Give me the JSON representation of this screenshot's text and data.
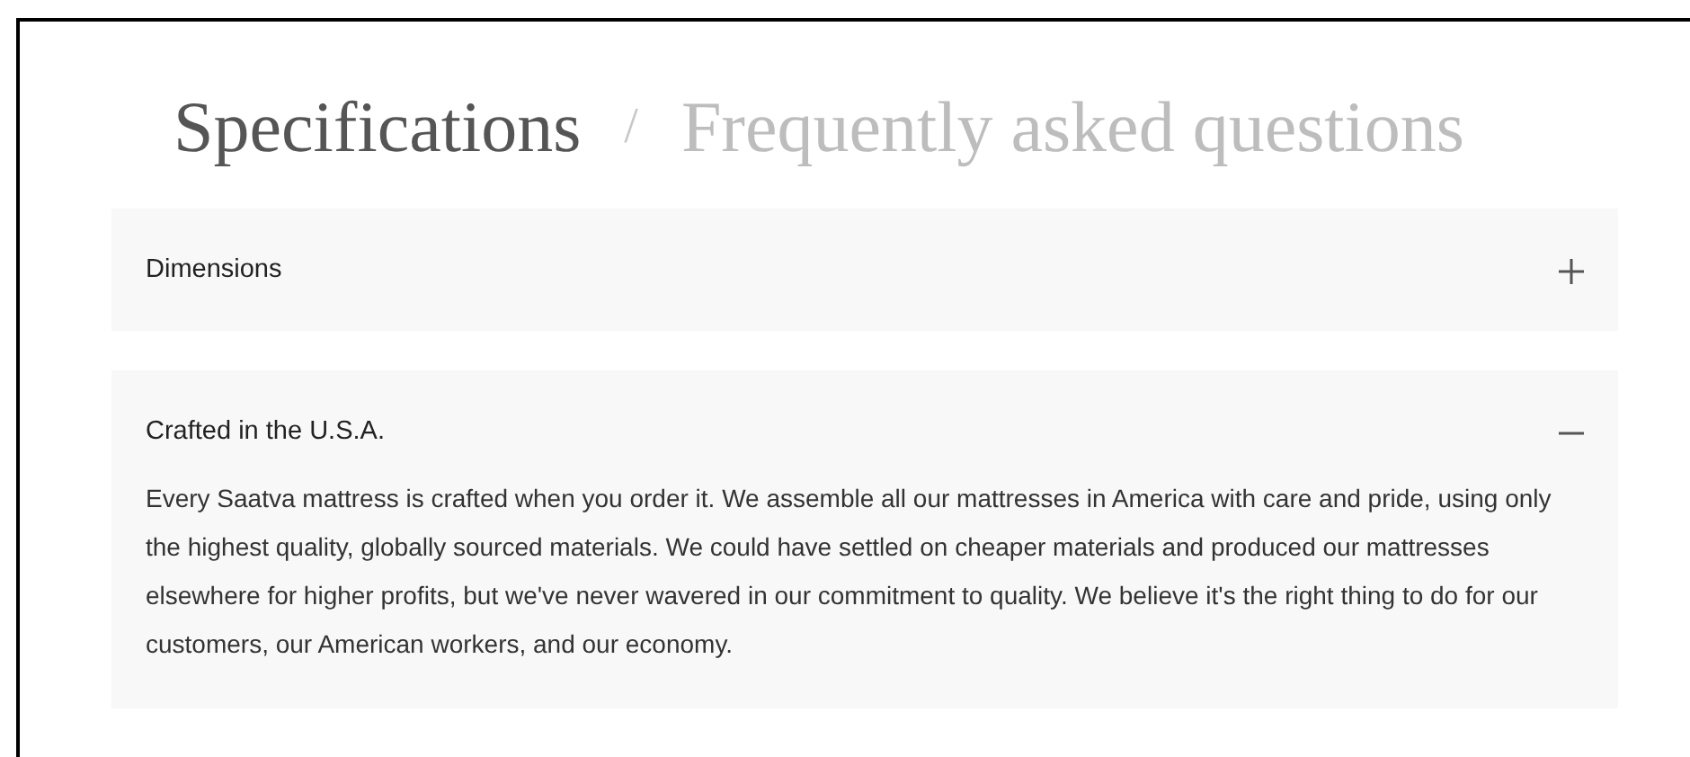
{
  "tabs": [
    {
      "label": "Specifications",
      "selected": true
    },
    {
      "label": "Frequently asked questions",
      "selected": false
    }
  ],
  "separator": "/",
  "accordion": [
    {
      "title": "Dimensions",
      "expanded": false
    },
    {
      "title": "Crafted in the U.S.A.",
      "expanded": true,
      "body": "Every Saatva mattress is crafted when you order it. We assemble all our mattresses in America with care and pride, using only the highest quality, globally sourced materials. We could have settled on cheaper materials and produced our mattresses elsewhere for higher profits, but we've never wavered in our commitment to quality. We believe it's the right thing to do for our customers, our American workers, and our economy."
    }
  ]
}
